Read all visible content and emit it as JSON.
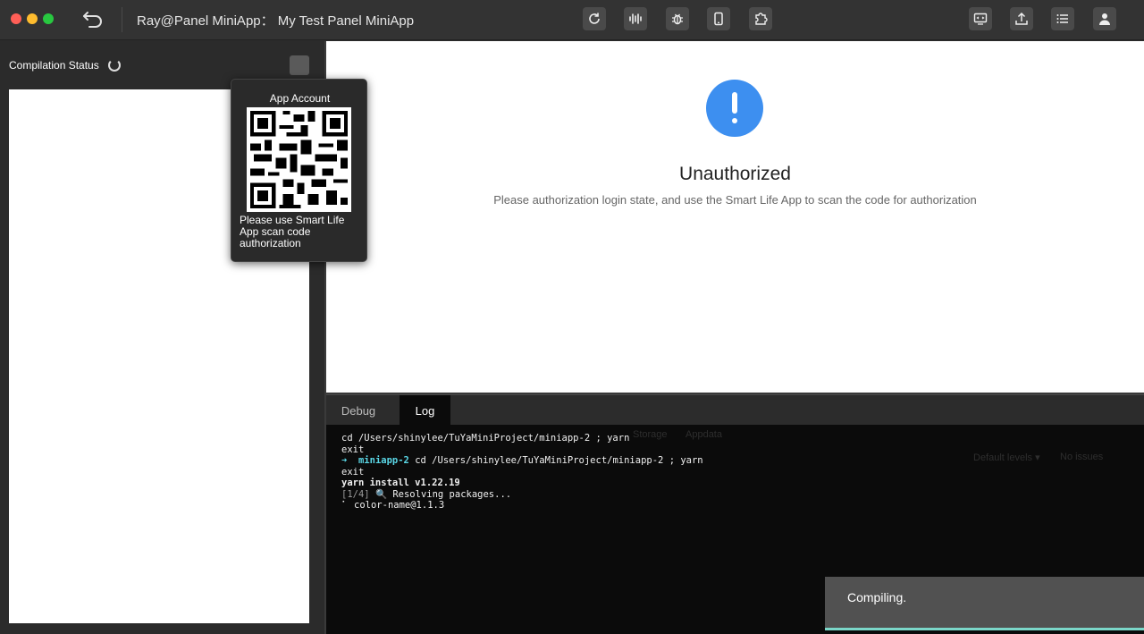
{
  "window": {
    "title": "Ray@Panel MiniApp： My Test Panel MiniApp"
  },
  "toolbar": {
    "icons": [
      "refresh-icon",
      "waveform-icon",
      "bug-icon",
      "phone-icon",
      "puzzle-icon",
      "preview-icon",
      "upload-icon",
      "list-icon",
      "user-icon"
    ]
  },
  "left": {
    "compilation_label": "Compilation Status"
  },
  "popup": {
    "title": "App Account",
    "instruction": "Please use Smart Life App scan code authorization"
  },
  "main": {
    "status_title": "Unauthorized",
    "status_desc": "Please authorization login state, and use the Smart Life App to scan the code for authorization",
    "accent_color": "#3d8ff0"
  },
  "console": {
    "tabs": [
      {
        "label": "Debug"
      },
      {
        "label": "Log"
      }
    ],
    "active_tab": "Log",
    "ghost": {
      "storage": "Storage",
      "appdata": "Appdata",
      "levels": "Default levels ▾",
      "issues": "No issues"
    },
    "lines": {
      "l1": "cd /Users/shinylee/TuYaMiniProject/miniapp-2 ; yarn",
      "l2": "exit",
      "l3_arrow": "➜",
      "l3_dir": "miniapp-2",
      "l3_cmd": "cd /Users/shinylee/TuYaMiniProject/miniapp-2 ; yarn",
      "l4": "exit",
      "l5": "yarn install v1.22.19",
      "l6_step": "[1/4]",
      "l6_text": "🔍 Resolving packages...",
      "l7": "⠁ color-name@1.1.3"
    }
  },
  "toast": {
    "message": "Compiling."
  }
}
